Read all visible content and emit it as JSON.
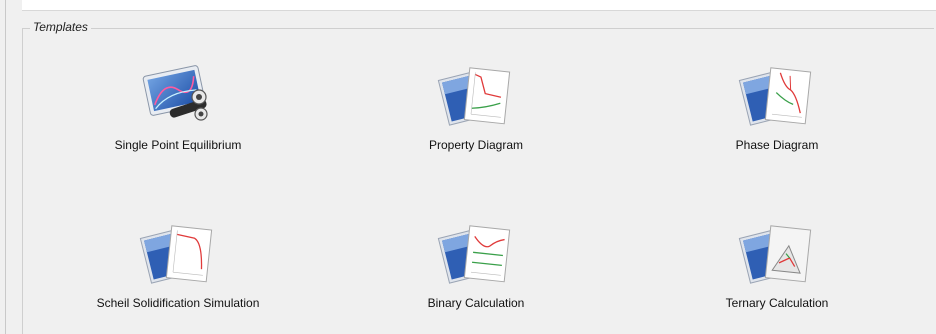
{
  "panel": {
    "title": "Templates"
  },
  "templates": [
    {
      "label": "Single Point Equilibrium",
      "icon": "single-point-equilibrium-icon"
    },
    {
      "label": "Property Diagram",
      "icon": "property-diagram-icon"
    },
    {
      "label": "Phase Diagram",
      "icon": "phase-diagram-icon"
    },
    {
      "label": "Scheil Solidification Simulation",
      "icon": "scheil-simulation-icon"
    },
    {
      "label": "Binary Calculation",
      "icon": "binary-calculation-icon"
    },
    {
      "label": "Ternary Calculation",
      "icon": "ternary-calculation-icon"
    }
  ]
}
